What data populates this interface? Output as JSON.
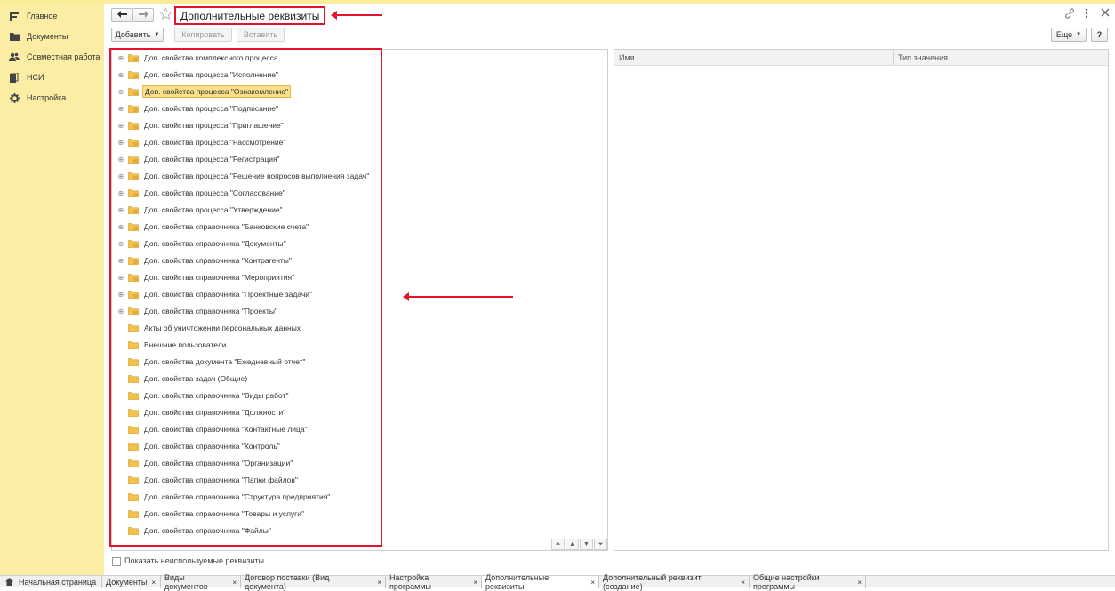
{
  "sidebar": {
    "items": [
      {
        "label": "Главное",
        "icon": "menu-lines-icon"
      },
      {
        "label": "Документы",
        "icon": "folder-icon"
      },
      {
        "label": "Совместная работа",
        "icon": "users-icon"
      },
      {
        "label": "НСИ",
        "icon": "book-icon"
      },
      {
        "label": "Настройка",
        "icon": "gear-icon"
      }
    ]
  },
  "header": {
    "title": "Дополнительные реквизиты",
    "back_icon": "back-arrow-icon",
    "forward_icon": "forward-arrow-icon",
    "star_icon": "star-icon",
    "link_icon": "link-icon",
    "more_icon": "more-vert-icon",
    "close_icon": "close-icon"
  },
  "toolbar": {
    "add_label": "Добавить",
    "copy_label": "Копировать",
    "paste_label": "Вставить",
    "more_label": "Еще",
    "help_label": "?"
  },
  "tree": {
    "items": [
      {
        "label": "Доп. свойства комплексного процесса",
        "expandable": true,
        "selected": false
      },
      {
        "label": "Доп. свойства процесса \"Исполнение\"",
        "expandable": true,
        "selected": false
      },
      {
        "label": "Доп. свойства процесса \"Ознакомление\"",
        "expandable": true,
        "selected": true
      },
      {
        "label": "Доп. свойства процесса \"Подписание\"",
        "expandable": true,
        "selected": false
      },
      {
        "label": "Доп. свойства процесса \"Приглашение\"",
        "expandable": true,
        "selected": false
      },
      {
        "label": "Доп. свойства процесса \"Рассмотрение\"",
        "expandable": true,
        "selected": false
      },
      {
        "label": "Доп. свойства процесса \"Регистрация\"",
        "expandable": true,
        "selected": false
      },
      {
        "label": "Доп. свойства процесса \"Решение вопросов выполнения задач\"",
        "expandable": true,
        "selected": false
      },
      {
        "label": "Доп. свойства процесса \"Согласование\"",
        "expandable": true,
        "selected": false
      },
      {
        "label": "Доп. свойства процесса \"Утверждение\"",
        "expandable": true,
        "selected": false
      },
      {
        "label": "Доп. свойства справочника \"Банковские счета\"",
        "expandable": true,
        "selected": false
      },
      {
        "label": "Доп. свойства справочника \"Документы\"",
        "expandable": true,
        "selected": false
      },
      {
        "label": "Доп. свойства справочника \"Контрагенты\"",
        "expandable": true,
        "selected": false
      },
      {
        "label": "Доп. свойства справочника \"Мероприятия\"",
        "expandable": true,
        "selected": false
      },
      {
        "label": "Доп. свойства справочника \"Проектные задачи\"",
        "expandable": true,
        "selected": false
      },
      {
        "label": "Доп. свойства справочника \"Проекты\"",
        "expandable": true,
        "selected": false
      },
      {
        "label": "Акты об уничтожении персональных данных",
        "expandable": false,
        "selected": false
      },
      {
        "label": "Внешние пользователи",
        "expandable": false,
        "selected": false
      },
      {
        "label": "Доп. свойства документа \"Ежедневный отчет\"",
        "expandable": false,
        "selected": false
      },
      {
        "label": "Доп. свойства задач (Общие)",
        "expandable": false,
        "selected": false
      },
      {
        "label": "Доп. свойства справочника \"Виды работ\"",
        "expandable": false,
        "selected": false
      },
      {
        "label": "Доп. свойства справочника \"Должности\"",
        "expandable": false,
        "selected": false
      },
      {
        "label": "Доп. свойства справочника \"Контактные лица\"",
        "expandable": false,
        "selected": false
      },
      {
        "label": "Доп. свойства справочника \"Контроль\"",
        "expandable": false,
        "selected": false
      },
      {
        "label": "Доп. свойства справочника \"Организации\"",
        "expandable": false,
        "selected": false
      },
      {
        "label": "Доп. свойства справочника \"Папки файлов\"",
        "expandable": false,
        "selected": false
      },
      {
        "label": "Доп. свойства справочника \"Структура предприятия\"",
        "expandable": false,
        "selected": false
      },
      {
        "label": "Доп. свойства справочника \"Товары и услуги\"",
        "expandable": false,
        "selected": false
      },
      {
        "label": "Доп. свойства справочника \"Файлы\"",
        "expandable": false,
        "selected": false
      }
    ]
  },
  "grid": {
    "columns": [
      "Имя",
      "Тип значения"
    ]
  },
  "footer": {
    "checkbox_label": "Показать неиспользуемые реквизиты",
    "checkbox_checked": false
  },
  "taskbar": {
    "home_label": "Начальная страница",
    "tabs": [
      {
        "label": "Документы",
        "active": false
      },
      {
        "label": "Виды документов",
        "active": false
      },
      {
        "label": "Договор поставки (Вид документа)",
        "active": false
      },
      {
        "label": "Настройка программы",
        "active": false
      },
      {
        "label": "Дополнительные реквизиты",
        "active": true
      },
      {
        "label": "Дополнительный реквизит (создание)",
        "active": false
      },
      {
        "label": "Общие настройки программы",
        "active": false
      }
    ],
    "close_glyph": "×"
  },
  "colors": {
    "sidebar_bg": "#fbeda3",
    "highlight_red": "#e0142b",
    "selection_bg": "#fcdf8b",
    "folder_yellow": "#f2c14e"
  }
}
